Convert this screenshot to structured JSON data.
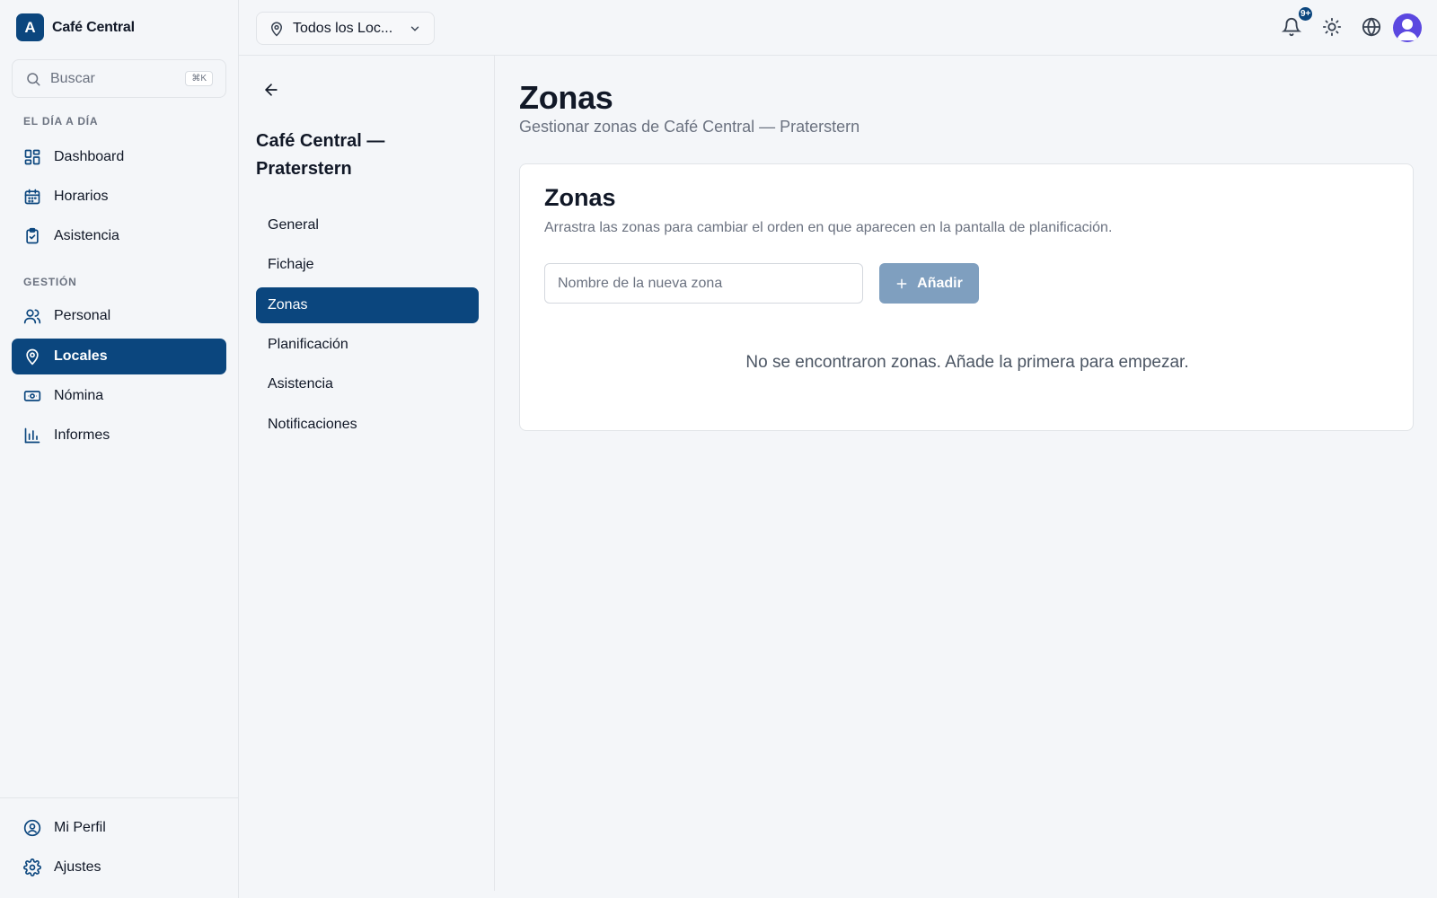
{
  "brand": {
    "logo_letter": "A",
    "name": "Café Central"
  },
  "search": {
    "placeholder": "Buscar",
    "shortcut": "⌘K"
  },
  "sidebar": {
    "sections": [
      {
        "label": "EL DÍA A DÍA"
      },
      {
        "label": "GESTIÓN"
      }
    ],
    "items": [
      {
        "label": "Dashboard",
        "icon": "dashboard-icon"
      },
      {
        "label": "Horarios",
        "icon": "calendar-icon"
      },
      {
        "label": "Asistencia",
        "icon": "clipboard-check-icon"
      },
      {
        "label": "Personal",
        "icon": "users-icon"
      },
      {
        "label": "Locales",
        "icon": "map-pin-icon",
        "active": true
      },
      {
        "label": "Nómina",
        "icon": "banknote-icon"
      },
      {
        "label": "Informes",
        "icon": "bar-chart-icon"
      }
    ],
    "footer_items": [
      {
        "label": "Mi Perfil",
        "icon": "user-circle-icon"
      },
      {
        "label": "Ajustes",
        "icon": "settings-icon"
      }
    ]
  },
  "topbar": {
    "location_select": "Todos los Loc...",
    "notifications_badge": "9+",
    "icons": [
      "bell-icon",
      "sun-icon",
      "globe-icon",
      "avatar"
    ]
  },
  "subpanel": {
    "title": "Café Central — Praterstern",
    "items": [
      {
        "label": "General"
      },
      {
        "label": "Fichaje"
      },
      {
        "label": "Zonas",
        "active": true
      },
      {
        "label": "Planificación"
      },
      {
        "label": "Asistencia"
      },
      {
        "label": "Notificaciones"
      }
    ]
  },
  "main": {
    "title": "Zonas",
    "subtitle": "Gestionar zonas de Café Central — Praterstern",
    "card": {
      "title": "Zonas",
      "description": "Arrastra las zonas para cambiar el orden en que aparecen en la pantalla de planificación.",
      "input_placeholder": "Nombre de la nueva zona",
      "input_value": "",
      "add_button": "Añadir",
      "empty_message": "No se encontraron zonas. Añade la primera para empezar."
    }
  },
  "colors": {
    "brand": "#0b467e",
    "button_disabled": "#7f9fbf",
    "avatar": "#5b48e0"
  }
}
